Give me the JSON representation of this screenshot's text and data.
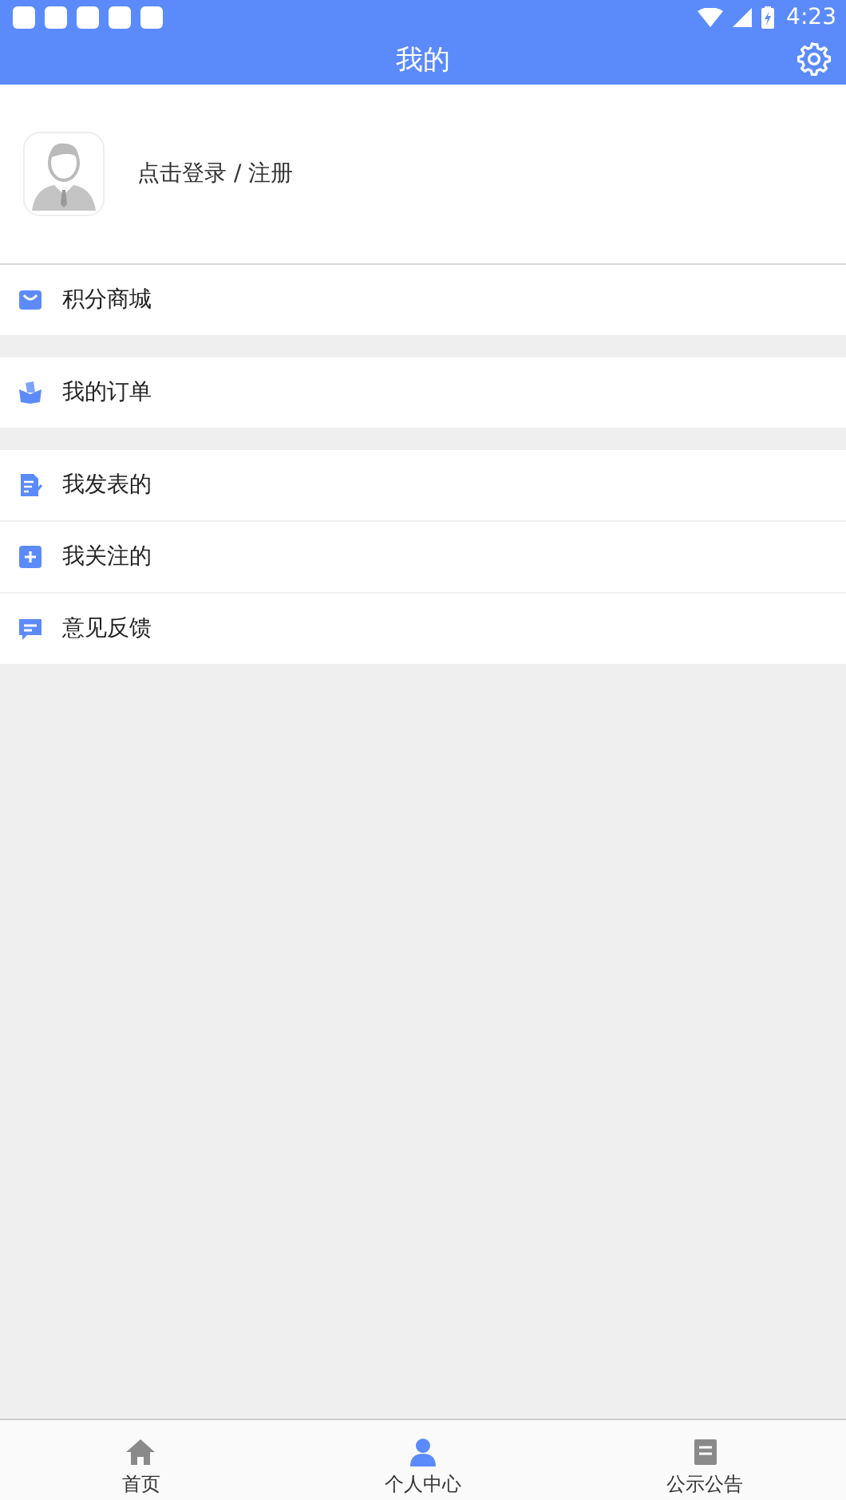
{
  "status_bar": {
    "time": "4:23"
  },
  "header": {
    "title": "我的"
  },
  "profile": {
    "login_text": "点击登录 / 注册"
  },
  "menu_groups": [
    {
      "items": [
        {
          "label": "积分商城"
        }
      ]
    },
    {
      "items": [
        {
          "label": "我的订单"
        }
      ]
    },
    {
      "items": [
        {
          "label": "我发表的"
        },
        {
          "label": "我关注的"
        },
        {
          "label": "意见反馈"
        }
      ]
    }
  ],
  "bottom_nav": [
    {
      "label": "首页",
      "selected": false
    },
    {
      "label": "个人中心",
      "selected": true
    },
    {
      "label": "公示公告",
      "selected": false
    }
  ]
}
